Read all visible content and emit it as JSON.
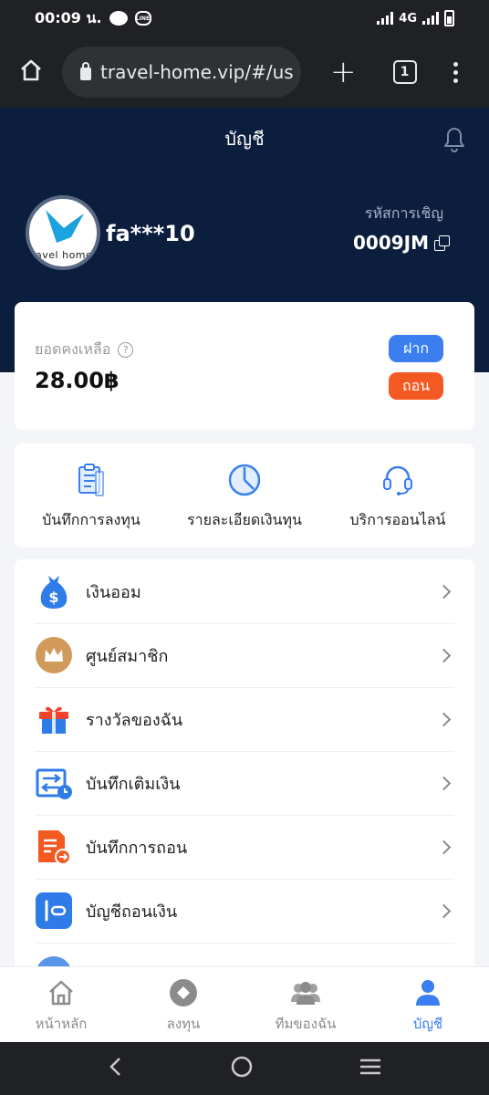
{
  "status_bar": {
    "time": "00:09 น.",
    "network": "4G",
    "line_label": "LINE"
  },
  "browser": {
    "url": "travel-home.vip/#/us",
    "tab_count": "1"
  },
  "header": {
    "title": "บัญชี"
  },
  "profile": {
    "avatar_text": "ravel home",
    "username": "fa***10",
    "invite_label": "รหัสการเชิญ",
    "invite_code": "0009JM"
  },
  "balance": {
    "label": "ยอดคงเหลือ",
    "help": "?",
    "amount": "28.00฿",
    "deposit_label": "ฝาก",
    "withdraw_label": "ถอน"
  },
  "quick_actions": [
    {
      "label": "บันทึกการลงทุน",
      "icon": "clipboard-icon"
    },
    {
      "label": "รายละเอียดเงินทุน",
      "icon": "pie-chart-icon"
    },
    {
      "label": "บริการออนไลน์",
      "icon": "headset-icon"
    }
  ],
  "menu": [
    {
      "label": "เงินออม",
      "icon": "money-bag-icon"
    },
    {
      "label": "ศูนย์สมาชิก",
      "icon": "crown-icon"
    },
    {
      "label": "รางวัลของฉัน",
      "icon": "gift-icon"
    },
    {
      "label": "บันทึกเติมเงิน",
      "icon": "recharge-record-icon"
    },
    {
      "label": "บันทึกการถอน",
      "icon": "withdraw-record-icon"
    },
    {
      "label": "บัญชีถอนเงิน",
      "icon": "wallet-icon"
    },
    {
      "label": "",
      "icon": "partial-icon"
    }
  ],
  "bottom_nav": [
    {
      "label": "หน้าหลัก",
      "icon": "home-icon"
    },
    {
      "label": "ลงทุน",
      "icon": "invest-icon"
    },
    {
      "label": "ทีมของฉัน",
      "icon": "team-icon"
    },
    {
      "label": "บัญชี",
      "icon": "account-icon"
    }
  ],
  "colors": {
    "header_bg": "#0b1e3d",
    "accent": "#3b7ef0",
    "withdraw": "#f25a22"
  }
}
